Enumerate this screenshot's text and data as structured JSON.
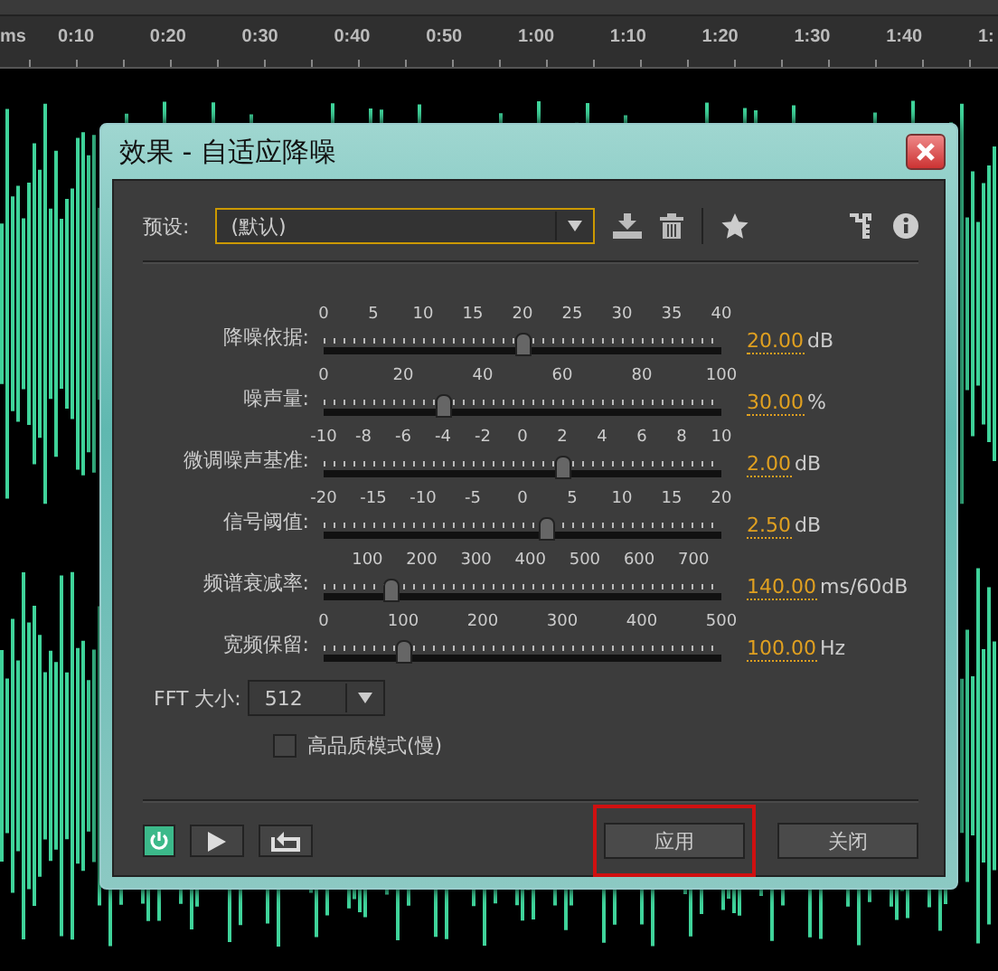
{
  "timeline": {
    "ruler_labels": [
      "ms",
      "0:10",
      "0:20",
      "0:30",
      "0:40",
      "0:50",
      "1:00",
      "1:10",
      "1:20",
      "1:30",
      "1:40",
      "1:"
    ]
  },
  "dialog": {
    "title": "效果 - 自适应降噪",
    "preset": {
      "label": "预设:",
      "value": "(默认)"
    },
    "sliders": [
      {
        "label": "降噪依据:",
        "kind": "full",
        "ticks": [
          "0",
          "5",
          "10",
          "15",
          "20",
          "25",
          "30",
          "35",
          "40"
        ],
        "level": 0.5,
        "value": "20.00",
        "unit": "dB"
      },
      {
        "label": "噪声量:",
        "kind": "full",
        "ticks": [
          "0",
          "20",
          "40",
          "60",
          "80",
          "100"
        ],
        "level": 0.3,
        "value": "30.00",
        "unit": "%"
      },
      {
        "label": "微调噪声基准:",
        "kind": "full",
        "ticks": [
          "-10",
          "-8",
          "-6",
          "-4",
          "-2",
          "0",
          "2",
          "4",
          "6",
          "8",
          "10"
        ],
        "level": 0.6,
        "value": "2.00",
        "unit": "dB"
      },
      {
        "label": "信号阈值:",
        "kind": "full",
        "ticks": [
          "-20",
          "-15",
          "-10",
          "-5",
          "0",
          "5",
          "10",
          "15",
          "20"
        ],
        "level": 0.56,
        "value": "2.50",
        "unit": "dB"
      },
      {
        "label": "频谱衰减率:",
        "kind": "inset",
        "ticks": [
          "100",
          "200",
          "300",
          "400",
          "500",
          "600",
          "700"
        ],
        "level": 0.17,
        "value": "140.00",
        "unit": "ms/60dB"
      },
      {
        "label": "宽频保留:",
        "kind": "full",
        "ticks": [
          "0",
          "100",
          "200",
          "300",
          "400",
          "500"
        ],
        "level": 0.2,
        "value": "100.00",
        "unit": "Hz"
      }
    ],
    "fft": {
      "label": "FFT 大小:",
      "value": "512"
    },
    "high_quality": {
      "label": "高品质模式(慢)",
      "checked": false
    },
    "power": {
      "on": true
    },
    "buttons": [
      {
        "label": "应用",
        "highlighted": true
      },
      {
        "label": "关闭",
        "highlighted": false
      }
    ]
  }
}
